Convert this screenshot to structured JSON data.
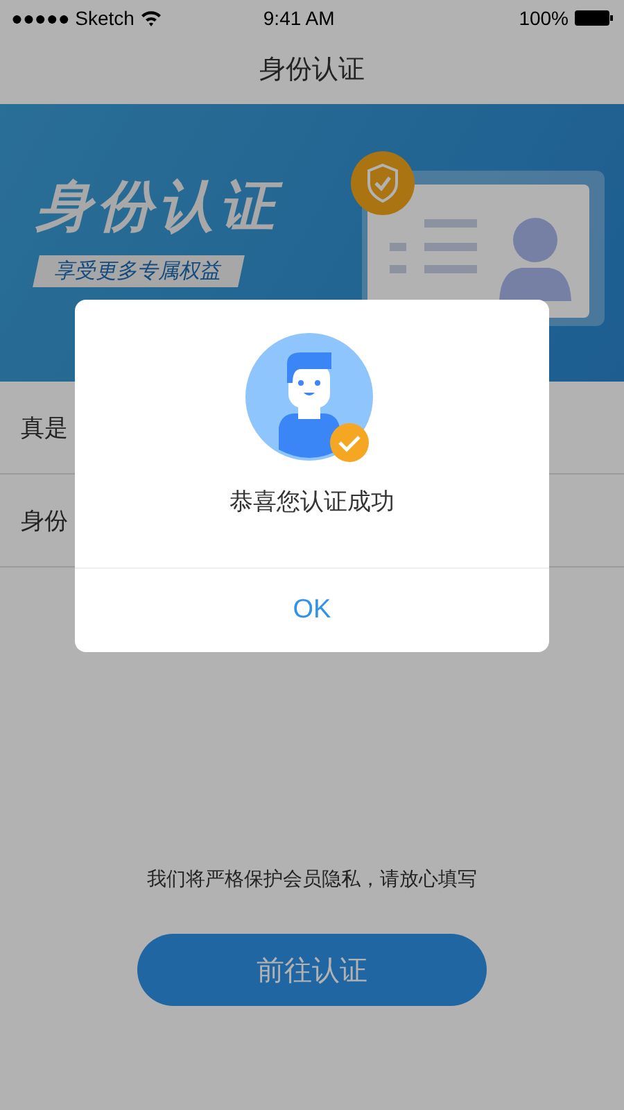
{
  "status_bar": {
    "carrier": "●●●●● Sketch",
    "time": "9:41 AM",
    "battery": "100%"
  },
  "nav": {
    "title": "身份认证"
  },
  "banner": {
    "title": "身份认证",
    "subtitle": "享受更多专属权益"
  },
  "form_rows": [
    {
      "label": "真是"
    },
    {
      "label": "身份"
    }
  ],
  "footer": {
    "note": "我们将严格保护会员隐私，请放心填写",
    "button": "前往认证"
  },
  "dialog": {
    "message": "恭喜您认证成功",
    "button": "OK"
  }
}
